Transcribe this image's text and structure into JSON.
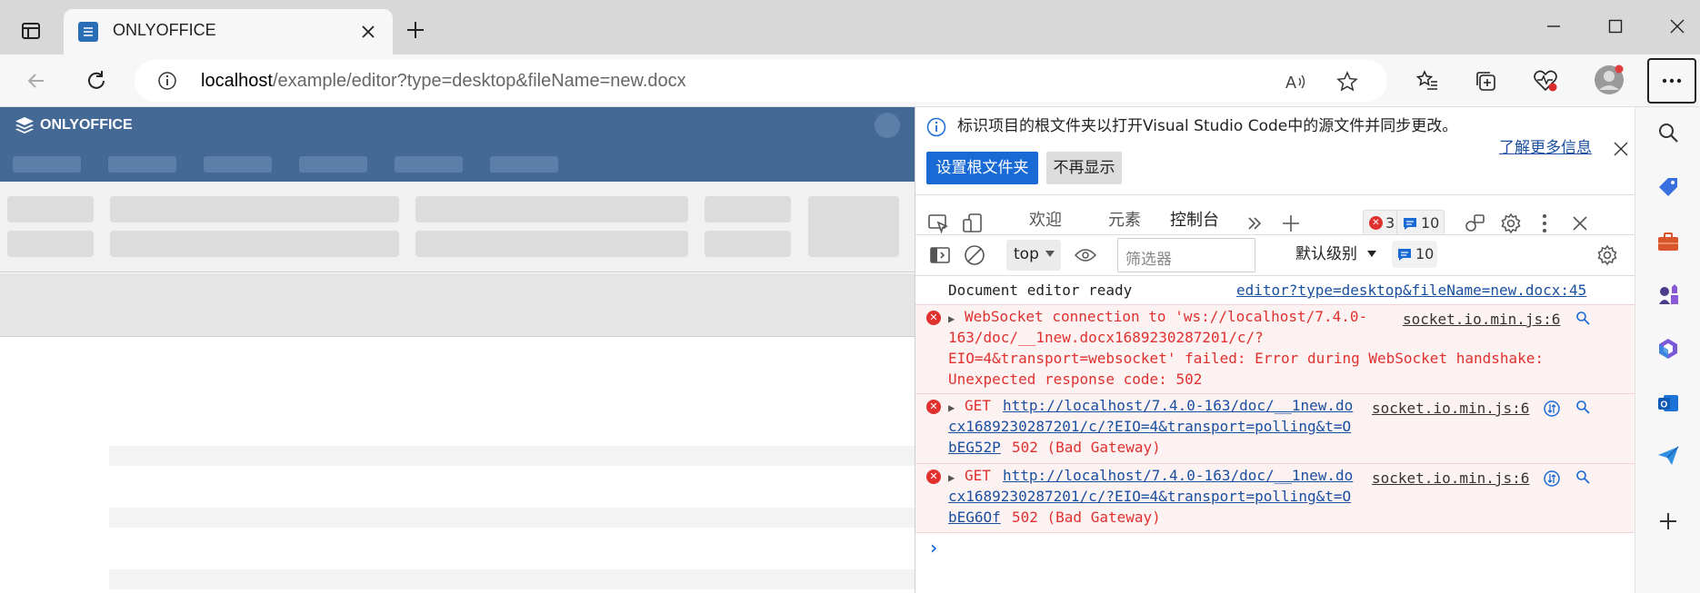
{
  "browser": {
    "tab_title": "ONLYOFFICE",
    "url_host": "localhost",
    "url_path": "/example/editor?type=desktop&fileName=new.docx",
    "window_min": "—",
    "window_max": "☐",
    "window_close": "✕"
  },
  "onlyoffice": {
    "logo_text": "ONLYOFFICE"
  },
  "devtools": {
    "info_message": "标识项目的根文件夹以打开Visual Studio Code中的源文件并同步更改。",
    "learn_more": "了解更多信息",
    "set_root_button": "设置根文件夹",
    "dont_show_button": "不再显示",
    "tabs": [
      {
        "label": "欢迎"
      },
      {
        "label": "元素"
      },
      {
        "label": "控制台"
      }
    ],
    "error_count": "3",
    "message_count": "10",
    "context": "top",
    "filter_placeholder": "筛选器",
    "level": "默认级别",
    "level_count": "10",
    "console": [
      {
        "text": "Document editor ready",
        "source": "editor?type=desktop&fileName=new.docx:45"
      },
      {
        "line1": "WebSocket connection to 'ws://localhost/7.4.0-",
        "line2": "163/doc/__1new.docx1689230287201/c/?",
        "line3": "EIO=4&transport=websocket' failed: Error during WebSocket handshake:",
        "line4": "Unexpected response code: 502",
        "source": "socket.io.min.js:6"
      },
      {
        "method": "GET",
        "url1": "http://localhost/7.4.0-163/doc/__1new.do",
        "url2": "cx1689230287201/c/?EIO=4&transport=polling&t=O",
        "url3": "bEG52P",
        "status": "502 (Bad Gateway)",
        "source": "socket.io.min.js:6"
      },
      {
        "method": "GET",
        "url1": "http://localhost/7.4.0-163/doc/__1new.do",
        "url2": "cx1689230287201/c/?EIO=4&transport=polling&t=O",
        "url3": "bEG6Of",
        "status": "502 (Bad Gateway)",
        "source": "socket.io.min.js:6"
      }
    ],
    "prompt": "›"
  }
}
